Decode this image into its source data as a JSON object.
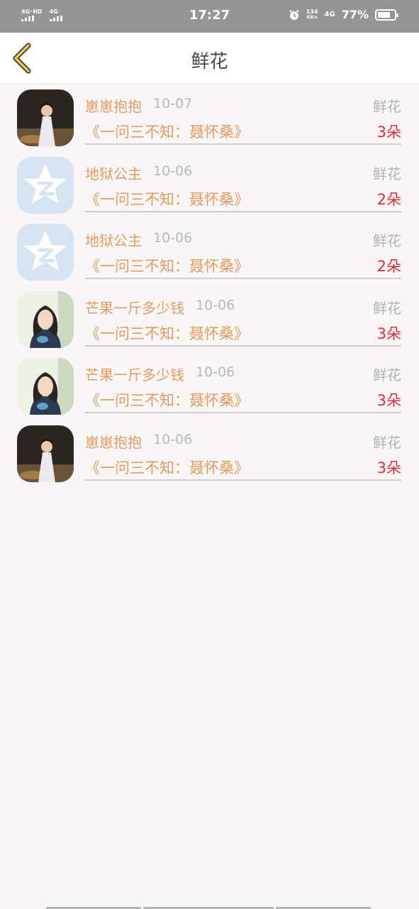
{
  "status_bar": {
    "signal1_label": "4G⁺HD",
    "signal2_label": "4G",
    "time": "17:27",
    "speed_value": "134",
    "speed_unit": "KB/s",
    "network": "4G",
    "battery_percent": "77%",
    "battery_level": 0.77
  },
  "header": {
    "title": "鲜花",
    "back_icon": "chevron-left-icon",
    "back_color": "#e8c84a"
  },
  "colors": {
    "name": "#e39a63",
    "count": "#d9303a",
    "muted": "#b3b3b3"
  },
  "items": [
    {
      "sender": "崽崽抱抱",
      "date": "10-07",
      "gift": "鲜花",
      "work": "《一问三不知：聂怀桑》",
      "count": "3朵",
      "avatar": "swordsman-avatar"
    },
    {
      "sender": "地狱公主",
      "date": "10-06",
      "gift": "鲜花",
      "work": "《一问三不知：聂怀桑》",
      "count": "2朵",
      "avatar": "qzone-star-avatar"
    },
    {
      "sender": "地狱公主",
      "date": "10-06",
      "gift": "鲜花",
      "work": "《一问三不知：聂怀桑》",
      "count": "2朵",
      "avatar": "qzone-star-avatar"
    },
    {
      "sender": "芒果一斤多少钱",
      "date": "10-06",
      "gift": "鲜花",
      "work": "《一问三不知：聂怀桑》",
      "count": "3朵",
      "avatar": "girl-avatar"
    },
    {
      "sender": "芒果一斤多少钱",
      "date": "10-06",
      "gift": "鲜花",
      "work": "《一问三不知：聂怀桑》",
      "count": "3朵",
      "avatar": "girl-avatar"
    },
    {
      "sender": "崽崽抱抱",
      "date": "10-06",
      "gift": "鲜花",
      "work": "《一问三不知：聂怀桑》",
      "count": "3朵",
      "avatar": "swordsman-avatar"
    }
  ]
}
